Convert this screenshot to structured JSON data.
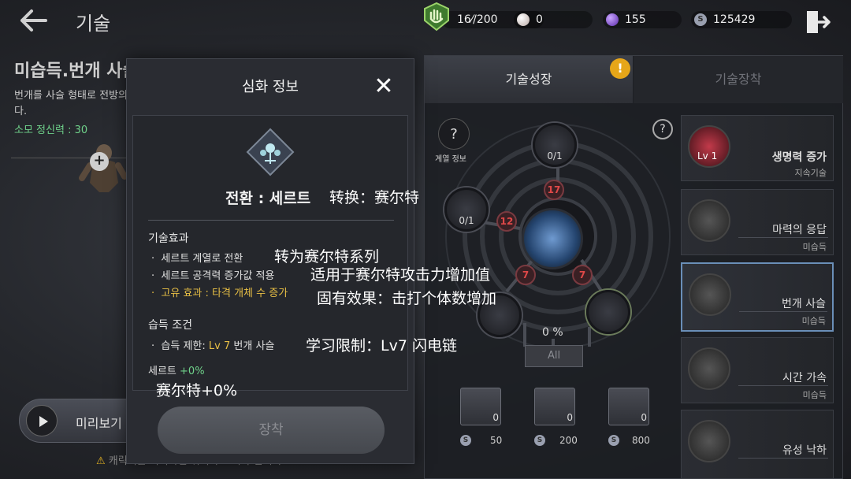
{
  "header": {
    "title": "기술",
    "back_icon": "arrow-left-icon",
    "exit_icon": "exit-door-icon"
  },
  "resources": {
    "stamina": "16⁄/200",
    "pearl": "0",
    "gem": "155",
    "silver": "125429"
  },
  "skill_info": {
    "name": "미습득.번개 사슬",
    "description": "번개를 사슬 형태로 전방의 적들에게 연쇄 시켜 타격한다.",
    "cost": "소모 정신력 : 30"
  },
  "preview": {
    "label": "미리보기"
  },
  "warning": {
    "text": "캐릭터를 터치하면 위치가 초기화 됩니다."
  },
  "tabs": [
    {
      "label": "기술성장",
      "active": true
    },
    {
      "label": "기술장착",
      "active": false
    }
  ],
  "alert_badge": "!",
  "wheel": {
    "help": "?",
    "lineage_label": "계열 정보",
    "lineage_icon": "?",
    "top_node": "0/1",
    "left_node": "0/1",
    "badges": [
      "17",
      "12",
      "7",
      "7"
    ],
    "progress": "0 %",
    "all_button": "All"
  },
  "books": [
    {
      "count": "0",
      "price": "50"
    },
    {
      "count": "0",
      "price": "200"
    },
    {
      "count": "0",
      "price": "800"
    }
  ],
  "coin_symbol": "S",
  "skill_list": [
    {
      "name": "생명력 증가",
      "sub": "지속기술",
      "level": "Lv 1"
    },
    {
      "name": "마력의 응답",
      "sub": "미습득"
    },
    {
      "name": "번개 사슬",
      "sub": "미습득"
    },
    {
      "name": "시간 가속",
      "sub": "미습득"
    },
    {
      "name": "유성 낙하",
      "sub": ""
    }
  ],
  "modal": {
    "title": "심화 정보",
    "close": "✕",
    "transform_kr": "전환 : 세르트",
    "transform_cn": "转换：赛尔特",
    "effect_head": "기술효과",
    "effects": [
      {
        "kr": "세르트 계열로 전환",
        "cn": "转为赛尔特系列"
      },
      {
        "kr": "세르트 공격력 증가값 적용",
        "cn": "适用于赛尔特攻击力增加值"
      },
      {
        "kr_prefix": "고유 효과 :",
        "kr": "타격 개체 수 증가",
        "cn": "固有效果：击打个体数增加"
      }
    ],
    "cond_head": "습득 조건",
    "condition": {
      "prefix": "습득 제한:",
      "level": "Lv 7",
      "skill": "번개 사슬",
      "cn": "学习限制：Lv7 闪电链"
    },
    "sert_label": "세르트",
    "sert_value": "+0%",
    "sert_cn": "赛尔特+0%",
    "equip_button": "장착"
  },
  "colors": {
    "accent_green": "#6fd18a",
    "gold": "#e8bf45",
    "alert": "#e6a619",
    "badge_red": "#e04848"
  }
}
